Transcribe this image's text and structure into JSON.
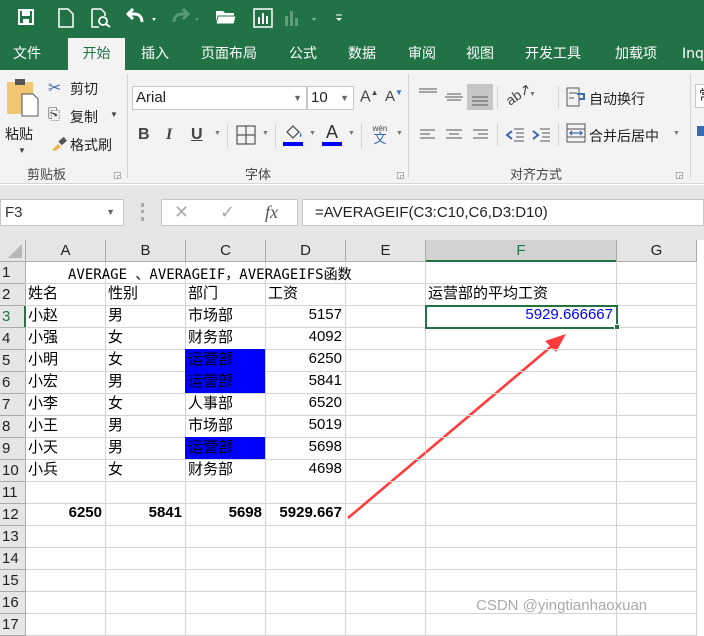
{
  "quick_access": {
    "icons": [
      "save-icon",
      "new-file-icon",
      "print-preview-icon",
      "undo-icon",
      "redo-icon",
      "open-folder-icon",
      "chart-icon",
      "pivot-chart-icon",
      "customize-qat-icon"
    ]
  },
  "ribbon_tabs": [
    {
      "label": "文件",
      "active": false
    },
    {
      "label": "开始",
      "active": true
    },
    {
      "label": "插入",
      "active": false
    },
    {
      "label": "页面布局",
      "active": false
    },
    {
      "label": "公式",
      "active": false
    },
    {
      "label": "数据",
      "active": false
    },
    {
      "label": "审阅",
      "active": false
    },
    {
      "label": "视图",
      "active": false
    },
    {
      "label": "开发工具",
      "active": false
    },
    {
      "label": "加载项",
      "active": false
    },
    {
      "label": "Inq",
      "active": false
    }
  ],
  "clipboard": {
    "paste": "粘贴",
    "cut": "剪切",
    "copy": "复制",
    "format_painter": "格式刷",
    "group_label": "剪贴板"
  },
  "font": {
    "name": "Arial",
    "size": "10",
    "bold": "B",
    "italic": "I",
    "underline": "U",
    "grow": "A",
    "shrink": "A",
    "font_color_letter": "A",
    "phonetic_top": "wén",
    "phonetic_bottom": "文",
    "fill_color": "#0000ff",
    "font_color": "#0000ff",
    "group_label": "字体"
  },
  "alignment": {
    "wrap_text": "自动换行",
    "merge_center": "合并后居中",
    "group_label": "对齐方式"
  },
  "number": {
    "format_partial": "常"
  },
  "formula_bar": {
    "name_box": "F3",
    "cancel": "✕",
    "enter": "✓",
    "fx": "fx",
    "formula": "=AVERAGEIF(C3:C10,C6,D3:D10)"
  },
  "sheet": {
    "columns": [
      "A",
      "B",
      "C",
      "D",
      "E",
      "F",
      "G"
    ],
    "selected_column": "F",
    "rows": [
      "1",
      "2",
      "3",
      "4",
      "5",
      "6",
      "7",
      "8",
      "9",
      "10",
      "11",
      "12",
      "13",
      "14",
      "15",
      "16",
      "17"
    ],
    "selected_row": "3",
    "title": "AVERAGE 、AVERAGEIF，AVERAGEIFS函数",
    "headers": [
      "姓名",
      "性别",
      "部门",
      "工资"
    ],
    "records": [
      {
        "name": "小赵",
        "gender": "男",
        "dept": "市场部",
        "salary": "5157",
        "highlight": false
      },
      {
        "name": "小强",
        "gender": "女",
        "dept": "财务部",
        "salary": "4092",
        "highlight": false
      },
      {
        "name": "小明",
        "gender": "女",
        "dept": "运营部",
        "salary": "6250",
        "highlight": true
      },
      {
        "name": "小宏",
        "gender": "男",
        "dept": "运营部",
        "salary": "5841",
        "highlight": true
      },
      {
        "name": "小李",
        "gender": "女",
        "dept": "人事部",
        "salary": "6520",
        "highlight": false
      },
      {
        "name": "小王",
        "gender": "男",
        "dept": "市场部",
        "salary": "5019",
        "highlight": false
      },
      {
        "name": "小天",
        "gender": "男",
        "dept": "运营部",
        "salary": "5698",
        "highlight": true
      },
      {
        "name": "小兵",
        "gender": "女",
        "dept": "财务部",
        "salary": "4698",
        "highlight": false
      }
    ],
    "row12": [
      "6250",
      "5841",
      "5698",
      "5929.667"
    ],
    "f2_label": "运营部的平均工资",
    "f3_value": "5929.666667",
    "highlight_color": "#0000ff",
    "result_color": "#0000ff",
    "annotation_arrow_color": "#ff3b3b"
  },
  "watermark": "CSDN @yingtianhaoxuan"
}
